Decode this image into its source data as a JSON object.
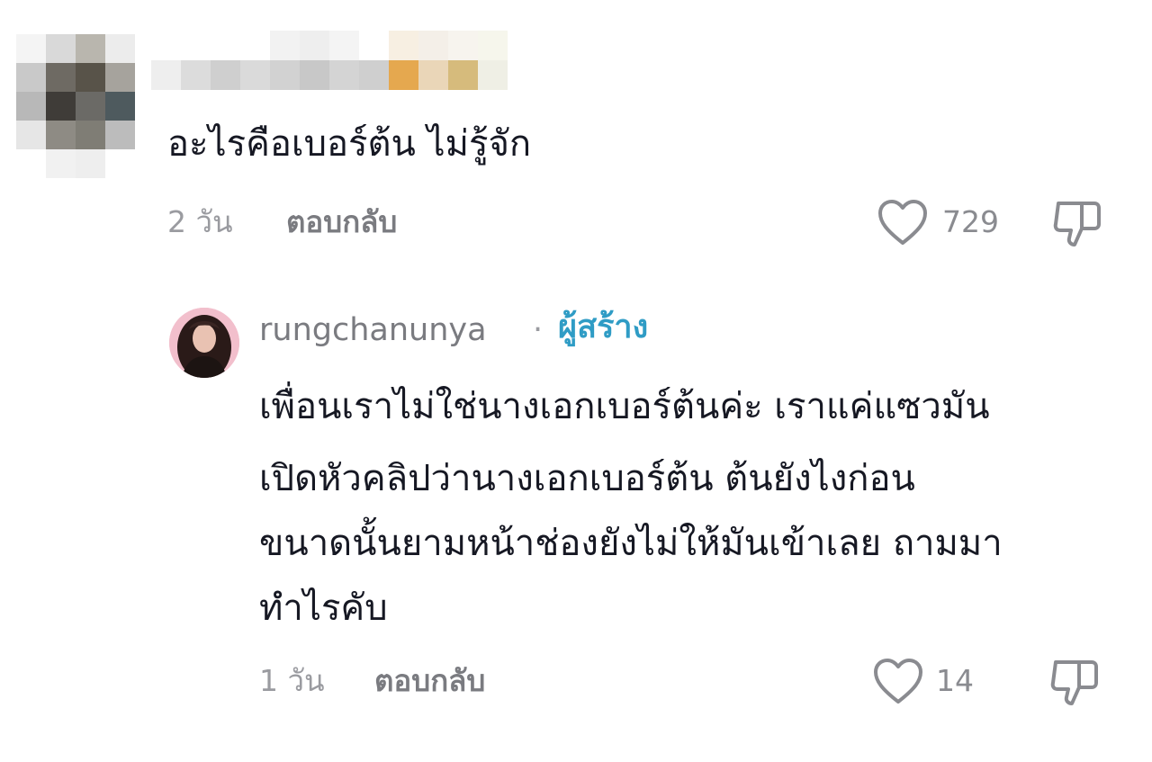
{
  "top_comment": {
    "text": "อะไรคือเบอร์ต้น ไม่รู้จัก",
    "time": "2 วัน",
    "reply_label": "ตอบกลับ",
    "like_count": "729",
    "icons": {
      "like": "heart-outline-icon",
      "dislike": "thumbs-down-outline-icon"
    }
  },
  "reply": {
    "username": "rungchanunya",
    "separator": "·",
    "creator_badge": "ผู้สร้าง",
    "text_lines": [
      "เพื่อนเราไม่ใช่นางเอกเบอร์ต้นค่ะ เราแค่แซวมัน",
      "เปิดหัวคลิปว่านางเอกเบอร์ต้น ต้นยังไงก่อน",
      "ขนาดนั้นยามหน้าช่องยังไม่ให้มันเข้าเลย ถามมา",
      "ทำไรคับ"
    ],
    "time": "1 วัน",
    "reply_label": "ตอบกลับ",
    "like_count": "14",
    "icons": {
      "like": "heart-outline-icon",
      "dislike": "thumbs-down-outline-icon"
    }
  },
  "colors": {
    "text": "#161823",
    "meta": "#9a9ba0",
    "creator_badge": "#2f9cc5",
    "background": "#ffffff"
  }
}
